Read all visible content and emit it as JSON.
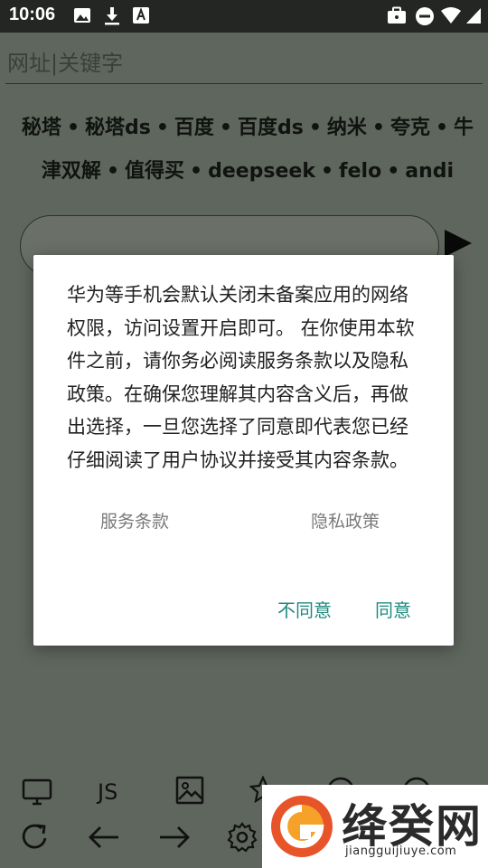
{
  "status_bar": {
    "time": "10:06"
  },
  "url_bar": {
    "placeholder": "网址|关键字"
  },
  "quick_links": [
    "秘塔",
    "秘塔ds",
    "百度",
    "百度ds",
    "纳米",
    "夸克",
    "牛津双解",
    "值得买",
    "deepseek",
    "felo",
    "andi"
  ],
  "quick_link_separator": "•",
  "toolbar": {
    "js_label": "JS"
  },
  "dialog": {
    "message": "华为等手机会默认关闭未备案应用的网络权限，访问设置开启即可。 在你使用本软件之前，请你务必阅读服务条款以及隐私政策。在确保您理解其内容含义后，再做出选择，一旦您选择了同意即代表您已经仔细阅读了用户协议并接受其内容条款。",
    "terms_link": "服务条款",
    "privacy_link": "隐私政策",
    "decline_label": "不同意",
    "accept_label": "同意"
  },
  "watermark": {
    "brand": "绛癸网",
    "url": "jiangguijiuye.com"
  },
  "colors": {
    "accent": "#1e8a80",
    "scrim": "#5f665d",
    "status_bar": "#232623"
  }
}
